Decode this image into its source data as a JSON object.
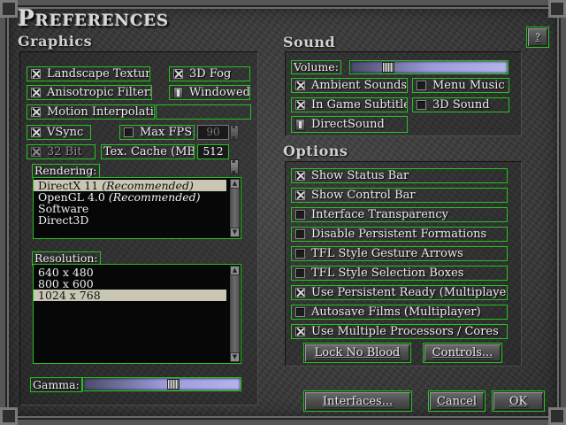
{
  "title": "Preferences",
  "help_button": "?",
  "graphics": {
    "heading": "Graphics",
    "landscape_textures": {
      "label": "Landscape Textures",
      "checked": true
    },
    "fog_3d": {
      "label": "3D Fog",
      "checked": true
    },
    "anisotropic": {
      "label": "Anisotropic Filtering",
      "checked": true
    },
    "windowed": {
      "label": "Windowed"
    },
    "motion_interp": {
      "label": "Motion Interpolation",
      "checked": true
    },
    "vsync": {
      "label": "VSync",
      "checked": true
    },
    "max_fps": {
      "label": "Max FPS:",
      "checked": false,
      "value": "90"
    },
    "bit32": {
      "label": "32 Bit",
      "checked": true
    },
    "tex_cache": {
      "label": "Tex. Cache (MB):",
      "value": "512"
    },
    "rendering": {
      "label": "Rendering:",
      "items": [
        {
          "name": "DirectX 11",
          "note": "(Recommended)"
        },
        {
          "name": "OpenGL 4.0",
          "note": "(Recommended)"
        },
        {
          "name": "Software",
          "note": ""
        },
        {
          "name": "Direct3D",
          "note": ""
        }
      ],
      "selected": "DirectX 11"
    },
    "resolution": {
      "label": "Resolution:",
      "items": [
        "640 x 480",
        "800 x 600",
        "1024 x 768"
      ],
      "selected": "1024 x 768"
    },
    "gamma": {
      "label": "Gamma:",
      "level_pct": 58
    }
  },
  "sound": {
    "heading": "Sound",
    "volume": {
      "label": "Volume:",
      "level_pct": 22
    },
    "ambient": {
      "label": "Ambient Sounds",
      "checked": true
    },
    "menu_music": {
      "label": "Menu Music",
      "checked": false
    },
    "subtitles": {
      "label": "In Game Subtitles",
      "checked": true
    },
    "sound_3d": {
      "label": "3D Sound",
      "checked": false
    },
    "directsound": {
      "label": "DirectSound"
    }
  },
  "options": {
    "heading": "Options",
    "items": [
      {
        "label": "Show Status Bar",
        "checked": true
      },
      {
        "label": "Show Control Bar",
        "checked": true
      },
      {
        "label": "Interface Transparency",
        "checked": false
      },
      {
        "label": "Disable Persistent Formations",
        "checked": false
      },
      {
        "label": "TFL Style Gesture Arrows",
        "checked": false
      },
      {
        "label": "TFL Style Selection Boxes",
        "checked": false
      },
      {
        "label": "Use Persistent Ready (Multiplayer)",
        "checked": true
      },
      {
        "label": "Autosave Films (Multiplayer)",
        "checked": false
      },
      {
        "label": "Use Multiple Processors / Cores",
        "checked": true
      }
    ],
    "lock_no_blood": "Lock No Blood",
    "controls": "Controls..."
  },
  "footer": {
    "interfaces": "Interfaces...",
    "cancel": "Cancel",
    "ok": "OK"
  },
  "colors": {
    "highlight": "#22c41e",
    "slider": "#9a9ad8",
    "selection": "#c9c6b4"
  }
}
